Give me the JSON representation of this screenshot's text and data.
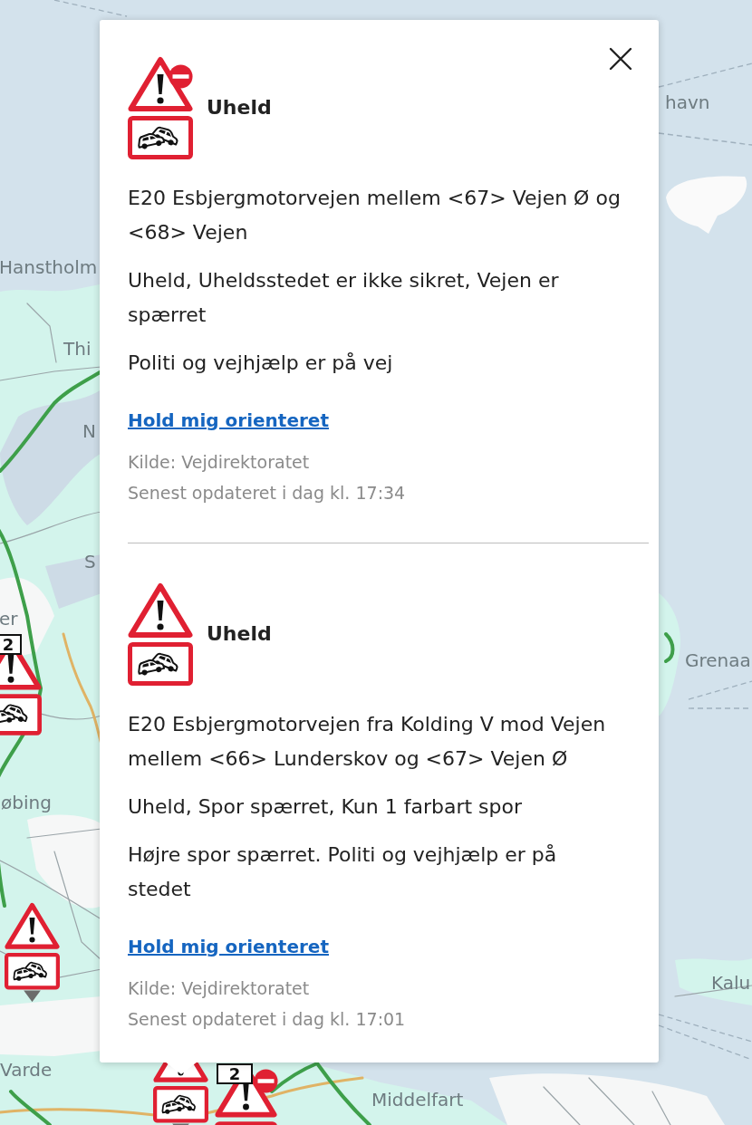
{
  "map": {
    "labels": [
      "havn",
      "Hanstholm",
      "Thi",
      "N",
      "S",
      "er",
      "øbing",
      "Varde",
      "Middelfart",
      "Grenaa",
      "Kalu"
    ],
    "markers": [
      {
        "badge": "2",
        "no_entry": false
      },
      {
        "no_entry": false
      },
      {
        "no_entry": false
      },
      {
        "badge": "2",
        "no_entry": true
      }
    ]
  },
  "popup": {
    "incidents": [
      {
        "no_entry": true,
        "title": "Uheld",
        "location": "E20 Esbjergmotorvejen mellem <67> Vejen Ø og <68> Vejen",
        "description": "Uheld, Uheldsstedet er ikke sikret, Vejen er spærret",
        "note": "Politi og vejhjælp er på vej",
        "link": "Hold mig orienteret",
        "source": "Kilde: Vejdirektoratet",
        "updated": "Senest opdateret i dag kl. 17:34"
      },
      {
        "no_entry": false,
        "title": "Uheld",
        "location": "E20 Esbjergmotorvejen fra Kolding V mod Vejen mellem <66> Lunderskov og <67> Vejen Ø",
        "description": "Uheld, Spor spærret, Kun 1 farbart spor",
        "note": "Højre spor spærret. Politi og vejhjælp er på stedet",
        "link": "Hold mig orienteret",
        "source": "Kilde: Vejdirektoratet",
        "updated": "Senest opdateret i dag kl. 17:01"
      }
    ]
  }
}
